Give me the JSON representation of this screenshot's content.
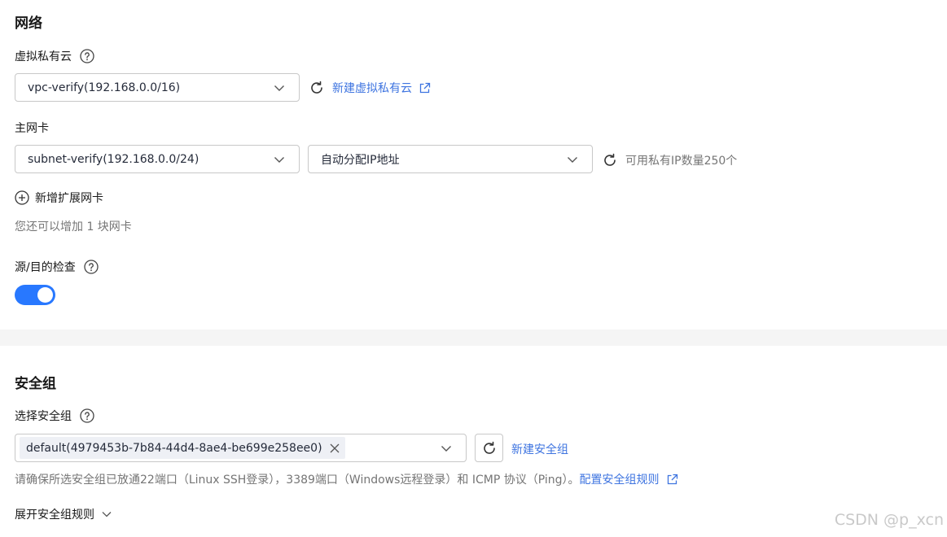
{
  "network": {
    "title": "网络",
    "vpc": {
      "label": "虚拟私有云",
      "selected": "vpc-verify(192.168.0.0/16)",
      "create_link": "新建虚拟私有云"
    },
    "primary_nic": {
      "label": "主网卡",
      "subnet": "subnet-verify(192.168.0.0/24)",
      "ip_mode": "自动分配IP地址",
      "available_ip": "可用私有IP数量250个"
    },
    "add_nic": {
      "label": "新增扩展网卡",
      "hint": "您还可以增加 1 块网卡"
    },
    "source_dest_check": {
      "label": "源/目的检查",
      "enabled": true
    }
  },
  "security_group": {
    "title": "安全组",
    "select_label": "选择安全组",
    "selected_tag": "default(4979453b-7b84-44d4-8ae4-be699e258ee0)",
    "create_link": "新建安全组",
    "notice": "请确保所选安全组已放通22端口（Linux SSH登录），3389端口（Windows远程登录）和 ICMP 协议（Ping）。",
    "rules_link": "配置安全组规则",
    "expand_rules": "展开安全组规则"
  },
  "watermark": "CSDN @p_xcn",
  "colors": {
    "accent": "#3e74e0",
    "toggle_on": "#2878ff",
    "muted_text": "#757575",
    "border": "#c8c8c8"
  },
  "icons": [
    "help-icon",
    "chevron-down-icon",
    "refresh-icon",
    "external-link-icon",
    "plus-circle-icon",
    "close-icon"
  ]
}
